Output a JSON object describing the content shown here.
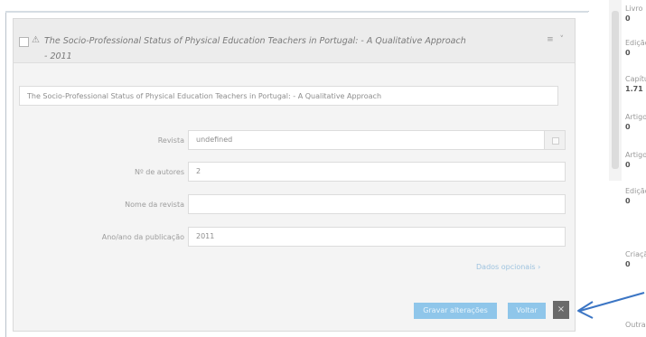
{
  "panel": {
    "title": "The Socio-Professional Status of Physical Education Teachers in Portugal: - A Qualitative Approach - 2011",
    "header_controls": "≡ ˅",
    "title_field_value": "The Socio-Professional Status of Physical Education Teachers in Portugal: - A Qualitative Approach"
  },
  "form": {
    "fields": [
      {
        "label": "Revista",
        "value": "undefined"
      },
      {
        "label": "Nº de autores",
        "value": "2"
      },
      {
        "label": "Nome da revista",
        "value": ""
      },
      {
        "label": "Ano/ano da publicação",
        "value": "2011"
      }
    ],
    "details_link": "Dados opcionais ›"
  },
  "buttons": {
    "save": "Gravar alterações",
    "cancel": "Voltar",
    "close": "×"
  },
  "sidebar": {
    "items": [
      {
        "label": "Livro",
        "value": "0"
      },
      {
        "label": "Edição",
        "value": "0"
      },
      {
        "label": "Capítulo",
        "value": "1.71"
      },
      {
        "label": "Artigo",
        "value": "0"
      },
      {
        "label": "Artigo",
        "value": "0"
      },
      {
        "label": "Edição revista",
        "value": "0"
      },
      {
        "label": "Criação desenv",
        "value": "0"
      },
      {
        "label": "Outras",
        "value": ""
      }
    ]
  },
  "colors": {
    "accent_button": "#8fc6ea",
    "close_button": "#6a6a6a",
    "annotation_arrow": "#3b75c4"
  }
}
